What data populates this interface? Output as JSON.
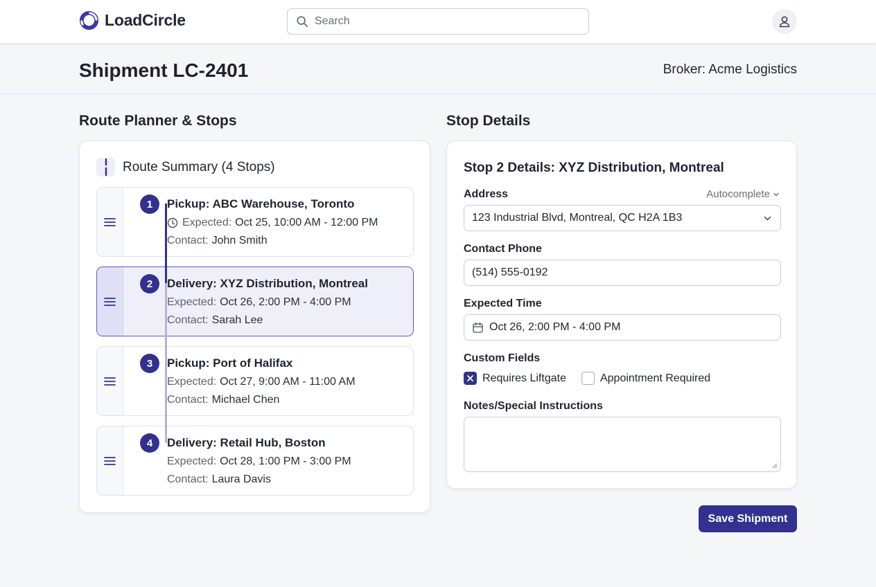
{
  "app": {
    "name": "LoadCircle"
  },
  "search": {
    "placeholder": "Search"
  },
  "page": {
    "title": "Shipment LC-2401",
    "broker": "Broker: Acme Logistics"
  },
  "route": {
    "section_title": "Route Planner & Stops",
    "summary_title": "Route Summary (4 Stops)",
    "expected_label": "Expected:",
    "contact_label": "Contact:",
    "stops": [
      {
        "num": "1",
        "title": "Pickup: ABC Warehouse, Toronto",
        "expected": "Oct 25, 10:00 AM - 12:00 PM",
        "contact": "John Smith"
      },
      {
        "num": "2",
        "title": "Delivery: XYZ Distribution, Montreal",
        "expected": "Oct 26, 2:00 PM - 4:00 PM",
        "contact": "Sarah Lee"
      },
      {
        "num": "3",
        "title": "Pickup: Port of Halifax",
        "expected": "Oct 27, 9:00 AM - 11:00 AM",
        "contact": "Michael Chen"
      },
      {
        "num": "4",
        "title": "Delivery: Retail Hub, Boston",
        "expected": "Oct 28, 1:00 PM - 3:00 PM",
        "contact": "Laura Davis"
      }
    ]
  },
  "details": {
    "section_title": "Stop Details",
    "title": "Stop 2 Details: XYZ Distribution, Montreal",
    "address_label": "Address",
    "autocomplete_label": "Autocomplete",
    "address_value": "123 Industrial Blvd, Montreal, QC H2A 1B3",
    "phone_label": "Contact Phone",
    "phone_value": "(514) 555-0192",
    "time_label": "Expected Time",
    "time_value": "Oct 26, 2:00 PM - 4:00 PM",
    "custom_label": "Custom Fields",
    "liftgate_label": "Requires Liftgate",
    "liftgate_checked": true,
    "appointment_label": "Appointment Required",
    "appointment_checked": false,
    "notes_label": "Notes/Special Instructions",
    "notes_value": ""
  },
  "actions": {
    "save_label": "Save Shipment"
  },
  "colors": {
    "accent": "#33318f",
    "accent_light": "#efeff9",
    "background": "#f5f6f8"
  }
}
